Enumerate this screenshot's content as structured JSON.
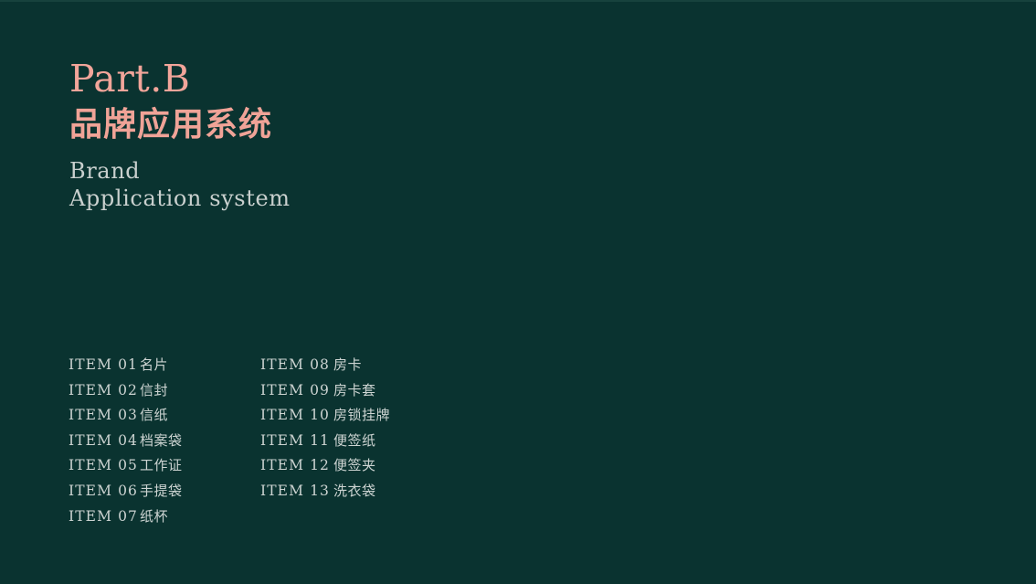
{
  "theme": {
    "background": "#0a3330",
    "accent_pink": "#f2a59a",
    "text_light": "#cdd4d2",
    "top_rule": "#17423d"
  },
  "title": {
    "part": "Part.B",
    "heading_cn": "品牌应用系统",
    "subtitle_line1": "Brand",
    "subtitle_line2": "Application system"
  },
  "item_list": {
    "columns": [
      {
        "items": [
          {
            "code": "ITEM  01",
            "name": "名片"
          },
          {
            "code": "ITEM  02",
            "name": "信封"
          },
          {
            "code": "ITEM  03",
            "name": "信纸"
          },
          {
            "code": "ITEM  04",
            "name": "档案袋"
          },
          {
            "code": "ITEM  05",
            "name": "工作证"
          },
          {
            "code": "ITEM  06",
            "name": "手提袋"
          },
          {
            "code": "ITEM  07",
            "name": "纸杯"
          }
        ]
      },
      {
        "items": [
          {
            "code": "ITEM  08",
            "name": "房卡"
          },
          {
            "code": "ITEM  09",
            "name": "房卡套"
          },
          {
            "code": "ITEM  10",
            "name": "房锁挂牌"
          },
          {
            "code": "ITEM  11",
            "name": "便签纸"
          },
          {
            "code": "ITEM  12",
            "name": "便签夹"
          },
          {
            "code": "ITEM  13",
            "name": "洗衣袋"
          }
        ]
      }
    ]
  }
}
